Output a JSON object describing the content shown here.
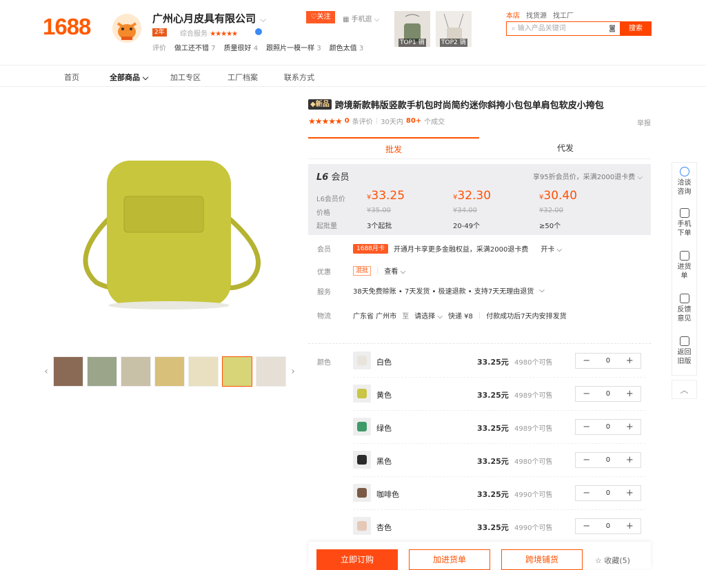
{
  "header": {
    "logo": "1688",
    "shop_name": "广州心月皮具有限公司",
    "years_badge": "2年",
    "service_label": "综合服务",
    "service_stars": "★★★★★",
    "reviews": [
      {
        "text": "做工还不错",
        "count": "7"
      },
      {
        "text": "质量很好",
        "count": "4"
      },
      {
        "text": "跟照片一模一样",
        "count": "3"
      },
      {
        "text": "颜色太值",
        "count": "3"
      }
    ],
    "reviews_label": "评价",
    "follow": "关注",
    "mobile": "手机逛",
    "top_tags": [
      "TOP1 销",
      "TOP2 销"
    ],
    "nav": [
      "本店",
      "找货源",
      "找工厂"
    ],
    "search_placeholder": "输入产品关键词",
    "search_button": "搜索"
  },
  "nav": {
    "items": [
      "首页",
      "全部商品",
      "加工专区",
      "工厂档案",
      "联系方式"
    ]
  },
  "product": {
    "new_tag": "新品",
    "title": "跨境新款韩版竖款手机包时尚简约迷你斜挎小包包单肩包软皮小挎包",
    "stars": "★★★★★",
    "review_count": "0",
    "review_label": "条评价",
    "sales_period": "30天内",
    "sales": "80+",
    "sales_label": "个成交",
    "report": "举报",
    "tabs": [
      "批发",
      "代发"
    ]
  },
  "member": {
    "level": "L6",
    "level_label": "会员",
    "promo": "享95折会员价，采满2000退卡费",
    "row_labels": [
      "L6会员价",
      "价格",
      "起批量"
    ],
    "tiers": [
      {
        "price": "33.25",
        "old": "¥35.00",
        "qty": "3个起批"
      },
      {
        "price": "32.30",
        "old": "¥34.00",
        "qty": "20-49个"
      },
      {
        "price": "30.40",
        "old": "¥32.00",
        "qty": "≥50个"
      }
    ],
    "currency": "¥"
  },
  "info": {
    "member_label": "会员",
    "card_tag": "1688月卡",
    "card_text": "开通月卡享更多金融权益，采满2000退卡费",
    "card_action": "开卡",
    "promo_label": "优惠",
    "promo_tag": "混批",
    "promo_action": "查看",
    "service_label": "服务",
    "service_text": "38天免费赊账 • 7天发货 • 极速退款 • 支持7天无理由退货",
    "logistics_label": "物流",
    "origin": "广东省 广州市",
    "to": "至",
    "dest": "请选择",
    "express": "快递 ¥8",
    "ship_note": "付款成功后7天内安排发货"
  },
  "variants": {
    "label": "颜色",
    "unit": "元",
    "items": [
      {
        "name": "白色",
        "price": "33.25",
        "stock": "4980个可售",
        "qty": "0",
        "swatch": "#e8e4dc"
      },
      {
        "name": "黄色",
        "price": "33.25",
        "stock": "4989个可售",
        "qty": "0",
        "swatch": "#c9c545"
      },
      {
        "name": "绿色",
        "price": "33.25",
        "stock": "4989个可售",
        "qty": "0",
        "swatch": "#3f9a6a"
      },
      {
        "name": "黑色",
        "price": "33.25",
        "stock": "4980个可售",
        "qty": "0",
        "swatch": "#2a2a2a"
      },
      {
        "name": "咖啡色",
        "price": "33.25",
        "stock": "4990个可售",
        "qty": "0",
        "swatch": "#7a5a45"
      },
      {
        "name": "杏色",
        "price": "33.25",
        "stock": "4990个可售",
        "qty": "0",
        "swatch": "#e6c8b8"
      }
    ]
  },
  "actions": {
    "buy": "立即订购",
    "cart": "加进货单",
    "cross": "跨境铺货",
    "fav": "收藏(5)"
  },
  "sidebar": [
    "洽谈咨询",
    "手机下单",
    "进货单",
    "反馈意见",
    "返回旧版"
  ],
  "colors": {
    "accent": "#ff5000",
    "product": "#c8c63c"
  }
}
